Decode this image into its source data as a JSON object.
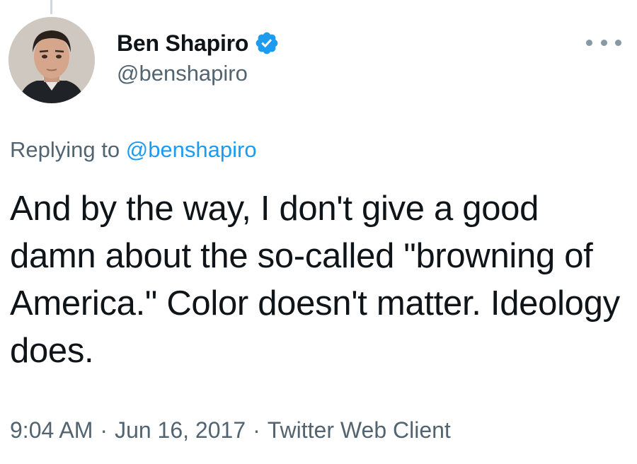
{
  "tweet": {
    "author": {
      "display_name": "Ben Shapiro",
      "handle": "@benshapiro",
      "verified": true
    },
    "reply": {
      "prefix": "Replying to",
      "handle": "@benshapiro"
    },
    "text": "And by the way, I don't give a good damn about the so-called \"browning of America.\" Color doesn't matter. Ideology does.",
    "time": "9:04 AM",
    "separator": "·",
    "date": "Jun 16, 2017",
    "client": "Twitter Web Client"
  },
  "icons": {
    "verified": "verified-badge-icon",
    "more": "more-options-icon"
  },
  "colors": {
    "text": "#0f1419",
    "secondary": "#536471",
    "link": "#1d9bf0",
    "verified": "#1d9bf0"
  }
}
